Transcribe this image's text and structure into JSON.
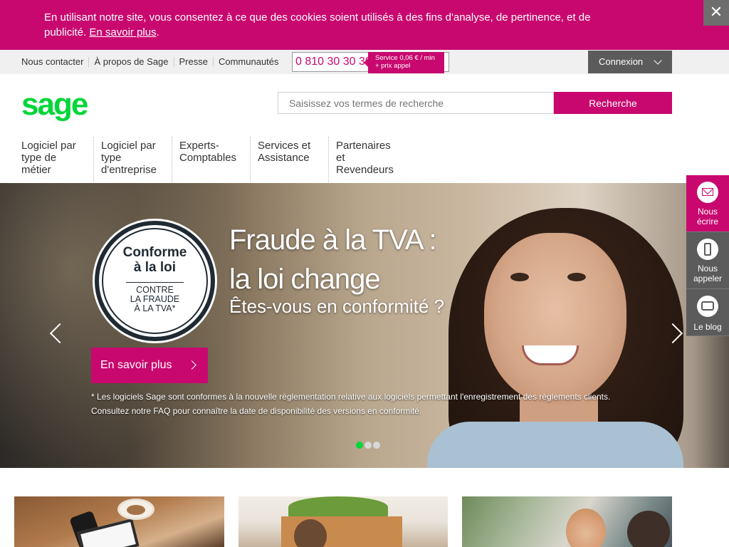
{
  "cookie": {
    "text": "En utilisant notre site, vous consentez à ce que des cookies soient utilisés à des fins d'analyse, de pertinence, et de publicité.",
    "link": "En savoir plus",
    "close": "✕"
  },
  "utility": {
    "links": [
      "Nous contacter",
      "À propos de Sage",
      "Presse",
      "Communautés"
    ],
    "phone": "0 810 30 30 30",
    "phone_tag_line1": "Service 0,06 € / min",
    "phone_tag_line2": "+ prix appel",
    "login": "Connexion"
  },
  "header": {
    "logo": "sage",
    "search_placeholder": "Saisissez vos termes de recherche",
    "search_button": "Recherche"
  },
  "nav": {
    "items": [
      "Logiciel par type de métier",
      "Logiciel par type d'entreprise",
      "Experts-Comptables",
      "Services et Assistance",
      "Partenaires et Revendeurs"
    ]
  },
  "hero": {
    "badge_line1": "Conforme",
    "badge_line2": "à la loi",
    "badge_line3": "CONTRE",
    "badge_line4": "LA FRAUDE",
    "badge_line5": "À LA TVA*",
    "title_line1": "Fraude à la TVA :",
    "title_line2": "la loi change",
    "subtitle": "Êtes-vous en conformité ?",
    "cta": "En savoir plus",
    "note_line1": "* Les logiciels Sage sont conformes à la nouvelle règlementation relative aux logiciels permettant l'enregistrement des règlements clients.",
    "note_line2": "Consultez notre FAQ pour connaître la date de disponibilité des versions en conformité.",
    "slides": 3,
    "active_slide": 1
  },
  "side": {
    "write_line1": "Nous",
    "write_line2": "écrire",
    "call_line1": "Nous",
    "call_line2": "appeler",
    "blog": "Le blog"
  },
  "colors": {
    "brand_pink": "#c8086f",
    "brand_green": "#00d639",
    "dark_gray": "#5b5b5b"
  }
}
